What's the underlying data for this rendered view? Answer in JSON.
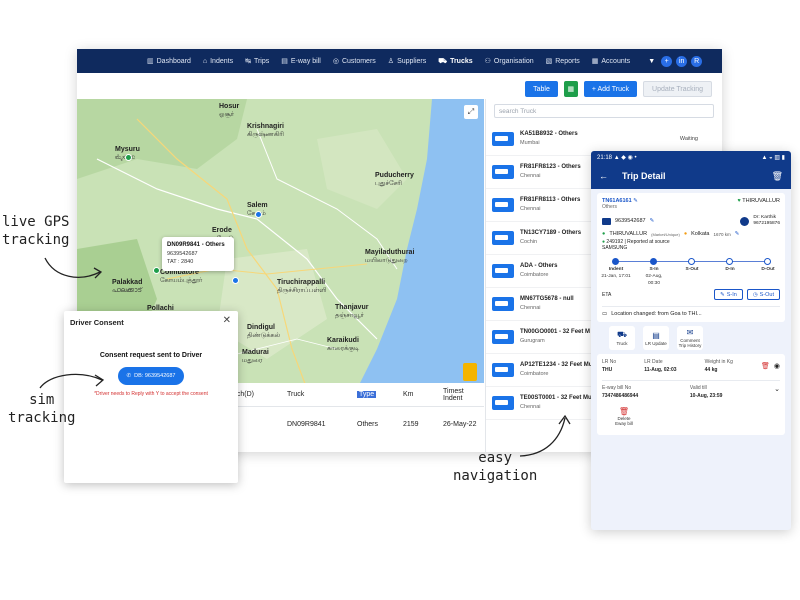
{
  "nav": {
    "items": [
      {
        "label": "Dashboard",
        "icon": "dashboard-icon",
        "glyph": "▥"
      },
      {
        "label": "Indents",
        "icon": "home-icon",
        "glyph": "⌂"
      },
      {
        "label": "Trips",
        "icon": "trips-icon",
        "glyph": "↹"
      },
      {
        "label": "E-way bill",
        "icon": "document-icon",
        "glyph": "▤"
      },
      {
        "label": "Customers",
        "icon": "customer-icon",
        "glyph": "◎"
      },
      {
        "label": "Suppliers",
        "icon": "user-icon",
        "glyph": "♙"
      },
      {
        "label": "Trucks",
        "icon": "truck-icon",
        "glyph": "⛟",
        "active": true
      },
      {
        "label": "Organisation",
        "icon": "organisation-icon",
        "glyph": "⚇"
      },
      {
        "label": "Reports",
        "icon": "report-icon",
        "glyph": "▧"
      },
      {
        "label": "Accounts",
        "icon": "accounts-icon",
        "glyph": "▦"
      }
    ]
  },
  "toolbar": {
    "table_label": "Table",
    "add_truck_label": "+ Add Truck",
    "update_tracking_label": "Update Tracking"
  },
  "map": {
    "places": [
      {
        "name": "Hosur",
        "local": "ஓசூர்"
      },
      {
        "name": "Krishnagiri",
        "local": "கிருஷ்ணகிரி"
      },
      {
        "name": "Mysuru",
        "local": "ಮೈಸೂರು"
      },
      {
        "name": "Salem",
        "local": "சேலம்"
      },
      {
        "name": "Puducherry",
        "local": "புதுச்சேரி"
      },
      {
        "name": "Erode",
        "local": "ஈரோடு"
      },
      {
        "name": "Coimbatore",
        "local": "கோயம்புத்தூர்"
      },
      {
        "name": "Palakkad",
        "local": "പാലക്കാട്"
      },
      {
        "name": "Mayiladuthurai",
        "local": "மயிலாடுதுறை"
      },
      {
        "name": "Tiruchirappalli",
        "local": "திருச்சிராப்பள்ளி"
      },
      {
        "name": "Thanjavur",
        "local": "தஞ்சாவூர்"
      },
      {
        "name": "Dindigul",
        "local": "திண்டுக்கல்"
      },
      {
        "name": "Karaikudi",
        "local": "காரைக்குடி"
      },
      {
        "name": "Madurai",
        "local": "மதுரை"
      },
      {
        "name": "Pollachi",
        "local": ""
      }
    ],
    "popup": {
      "title": "DN09R9841 - Others",
      "line1": "9639542687",
      "line2": "TAT : 2840"
    }
  },
  "table": {
    "headers": [
      "nch(D)",
      "Truck",
      "Type",
      "Km",
      "Timest Indent"
    ],
    "row": {
      "col1": "8",
      "truck": "DN09R9841",
      "type": "Others",
      "km": "2159",
      "date": "26-May-22"
    }
  },
  "list": {
    "search_placeholder": "search Truck",
    "items": [
      {
        "name": "KA51B8932 - Others",
        "city": "Mumbai",
        "status": "Waiting"
      },
      {
        "name": "FR81FR8123 - Others",
        "city": "Chennai",
        "status": ""
      },
      {
        "name": "FR81FR8113 - Others",
        "city": "Chennai",
        "status": ""
      },
      {
        "name": "TN13CY7189 - Others",
        "city": "Cochin",
        "status": ""
      },
      {
        "name": "ADA - Others",
        "city": "Coimbatore",
        "status": ""
      },
      {
        "name": "MN67TG5678 - null",
        "city": "Chennai",
        "status": ""
      },
      {
        "name": "TN00GO0001 - 32 Feet M",
        "city": "Gurugram",
        "status": ""
      },
      {
        "name": "AP12TE1234 - 32 Feet Mu",
        "city": "Coimbatore",
        "status": ""
      },
      {
        "name": "TE00ST0001 - 32 Feet Mu",
        "city": "Chennai",
        "status": ""
      }
    ]
  },
  "consent": {
    "title": "Driver Consent",
    "message": "Consent request sent to Driver",
    "button_label": "DB: 9639542687",
    "note": "*Driver needs to Reply with Y to accept the consent"
  },
  "phone": {
    "status_time": "21:18",
    "status_icons": "▲ ◆ ◉ •",
    "status_right": "▲ ◒ ▥ ▮",
    "title": "Trip Detail",
    "trip_id": "TN61A6161",
    "trip_sub": "Others",
    "origin_badge": "THIRUVALLUR",
    "driver_phone": "9639542687",
    "driver_name_label": "Dr: Karthik",
    "driver_name_phone": "9672195876",
    "route_from": "THIRUVALLUR",
    "route_from_note": "(Market/Unique)",
    "route_to": "Kolkata",
    "route_km": "1670 km",
    "indent_line": "249192 | Reported at source",
    "company": "SAMSUNG",
    "timeline": [
      {
        "label": "Indent",
        "sub": "21-Jan, 17:01"
      },
      {
        "label": "S-In",
        "sub": "02-Aug, 00:30"
      },
      {
        "label": "S-Out",
        "sub": ""
      },
      {
        "label": "D-In",
        "sub": ""
      },
      {
        "label": "D-Out",
        "sub": ""
      }
    ],
    "eta_label": "ETA",
    "s_in_btn": "S-In",
    "s_out_btn": "S-Out",
    "location_change": "Location changed: from Goa to THI...",
    "tiles": [
      {
        "label": "Truck",
        "icon": "truck-icon",
        "glyph": "⛟"
      },
      {
        "label": "LR Update",
        "icon": "document-icon",
        "glyph": "▤"
      },
      {
        "label": "Comment Trip History",
        "icon": "comment-icon",
        "glyph": "✉"
      }
    ],
    "lr": {
      "no_label": "LR No",
      "no_value": "THU",
      "date_label": "LR Date",
      "date_value": "11-Aug, 02:03",
      "weight_label": "Weight in Kg",
      "weight_value": "44 kg",
      "eway_label": "E-way bill No",
      "eway_value": "7347486486944",
      "valid_label": "Valid till",
      "valid_value": "10-Aug, 23:59"
    },
    "delete_label": "Delete Eway bill"
  },
  "annotations": {
    "gps": "live GPS\ntracking",
    "sim": "sim\ntracking",
    "nav": "easy\nnavigation"
  },
  "colors": {
    "nav_bg": "#0f2a5e",
    "accent": "#1a73e8",
    "phone_header": "#103a8a",
    "warning": "#d32f2f"
  }
}
